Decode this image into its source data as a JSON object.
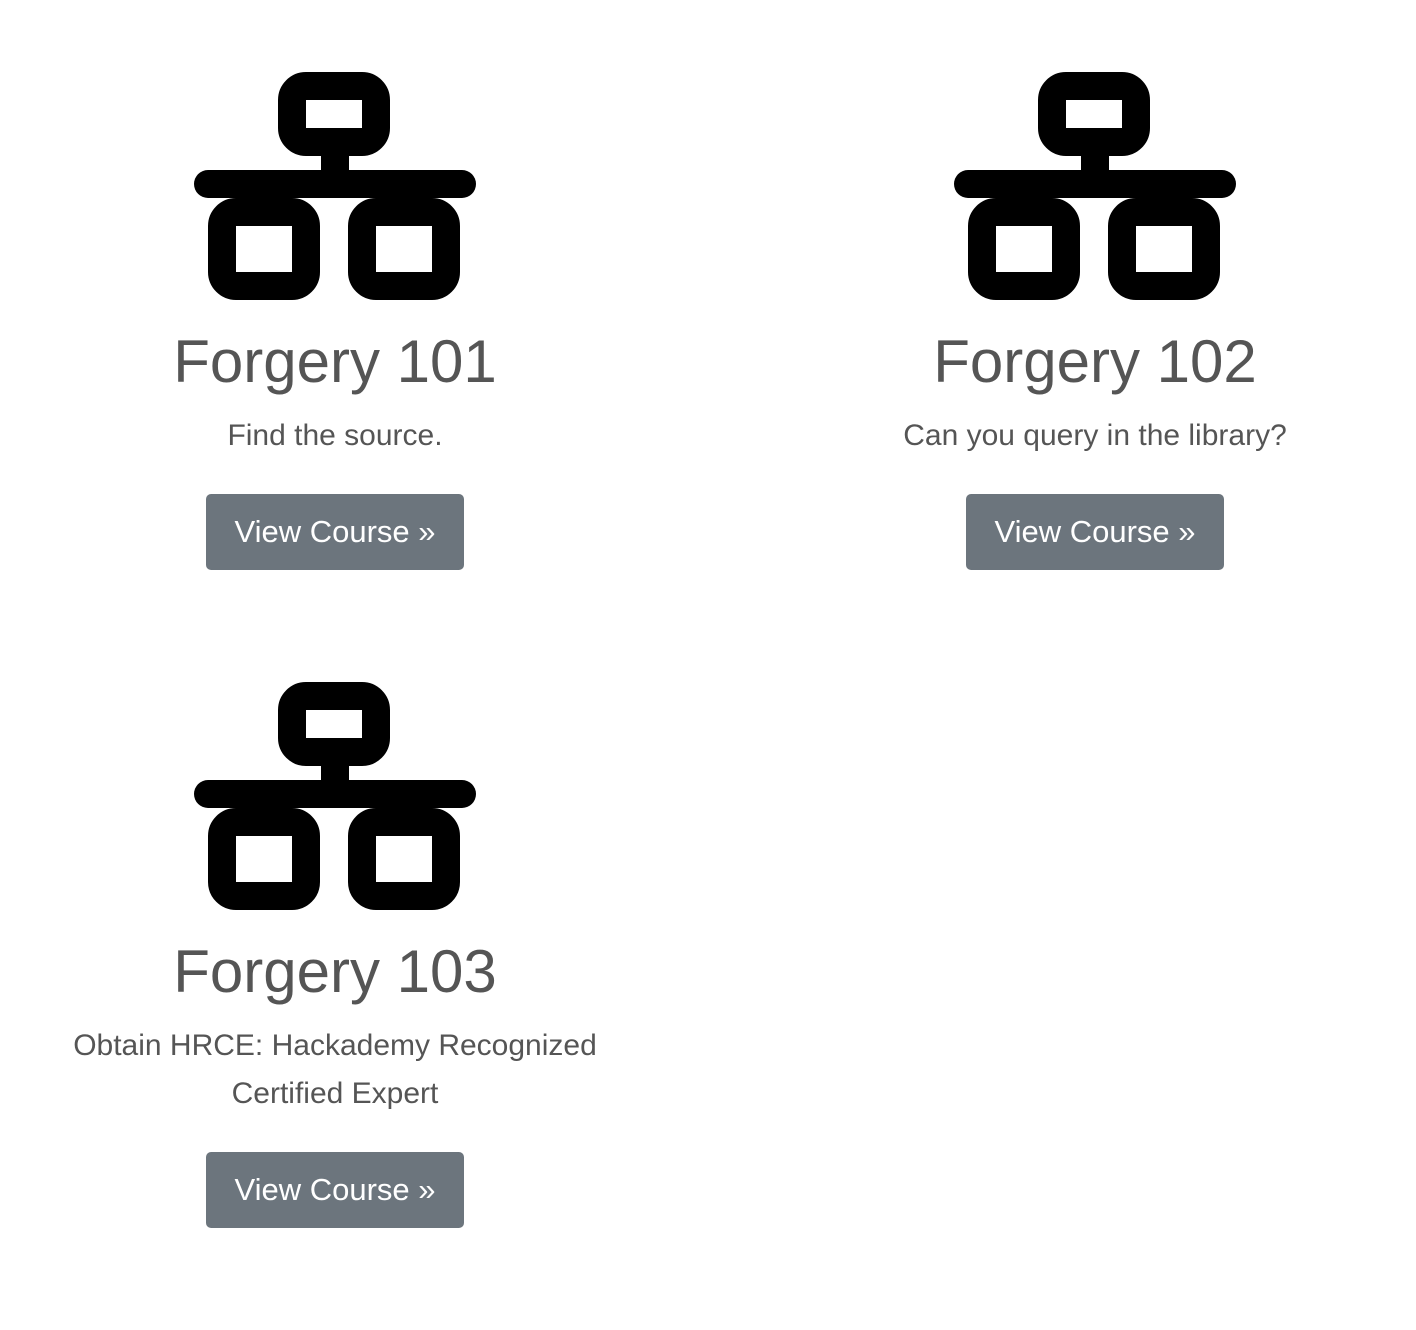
{
  "courses": [
    {
      "title": "Forgery 101",
      "description": "Find the source.",
      "button_label": "View Course »",
      "icon": "network-icon"
    },
    {
      "title": "Forgery 102",
      "description": "Can you query in the library?",
      "button_label": "View Course »",
      "icon": "network-icon"
    },
    {
      "title": "Forgery 103",
      "description": "Obtain HRCE: Hackademy Recognized Certified Expert",
      "button_label": "View Course »",
      "icon": "network-icon"
    }
  ],
  "colors": {
    "button_bg": "#6c757d",
    "button_text": "#ffffff",
    "text": "#555555",
    "icon": "#000000"
  }
}
